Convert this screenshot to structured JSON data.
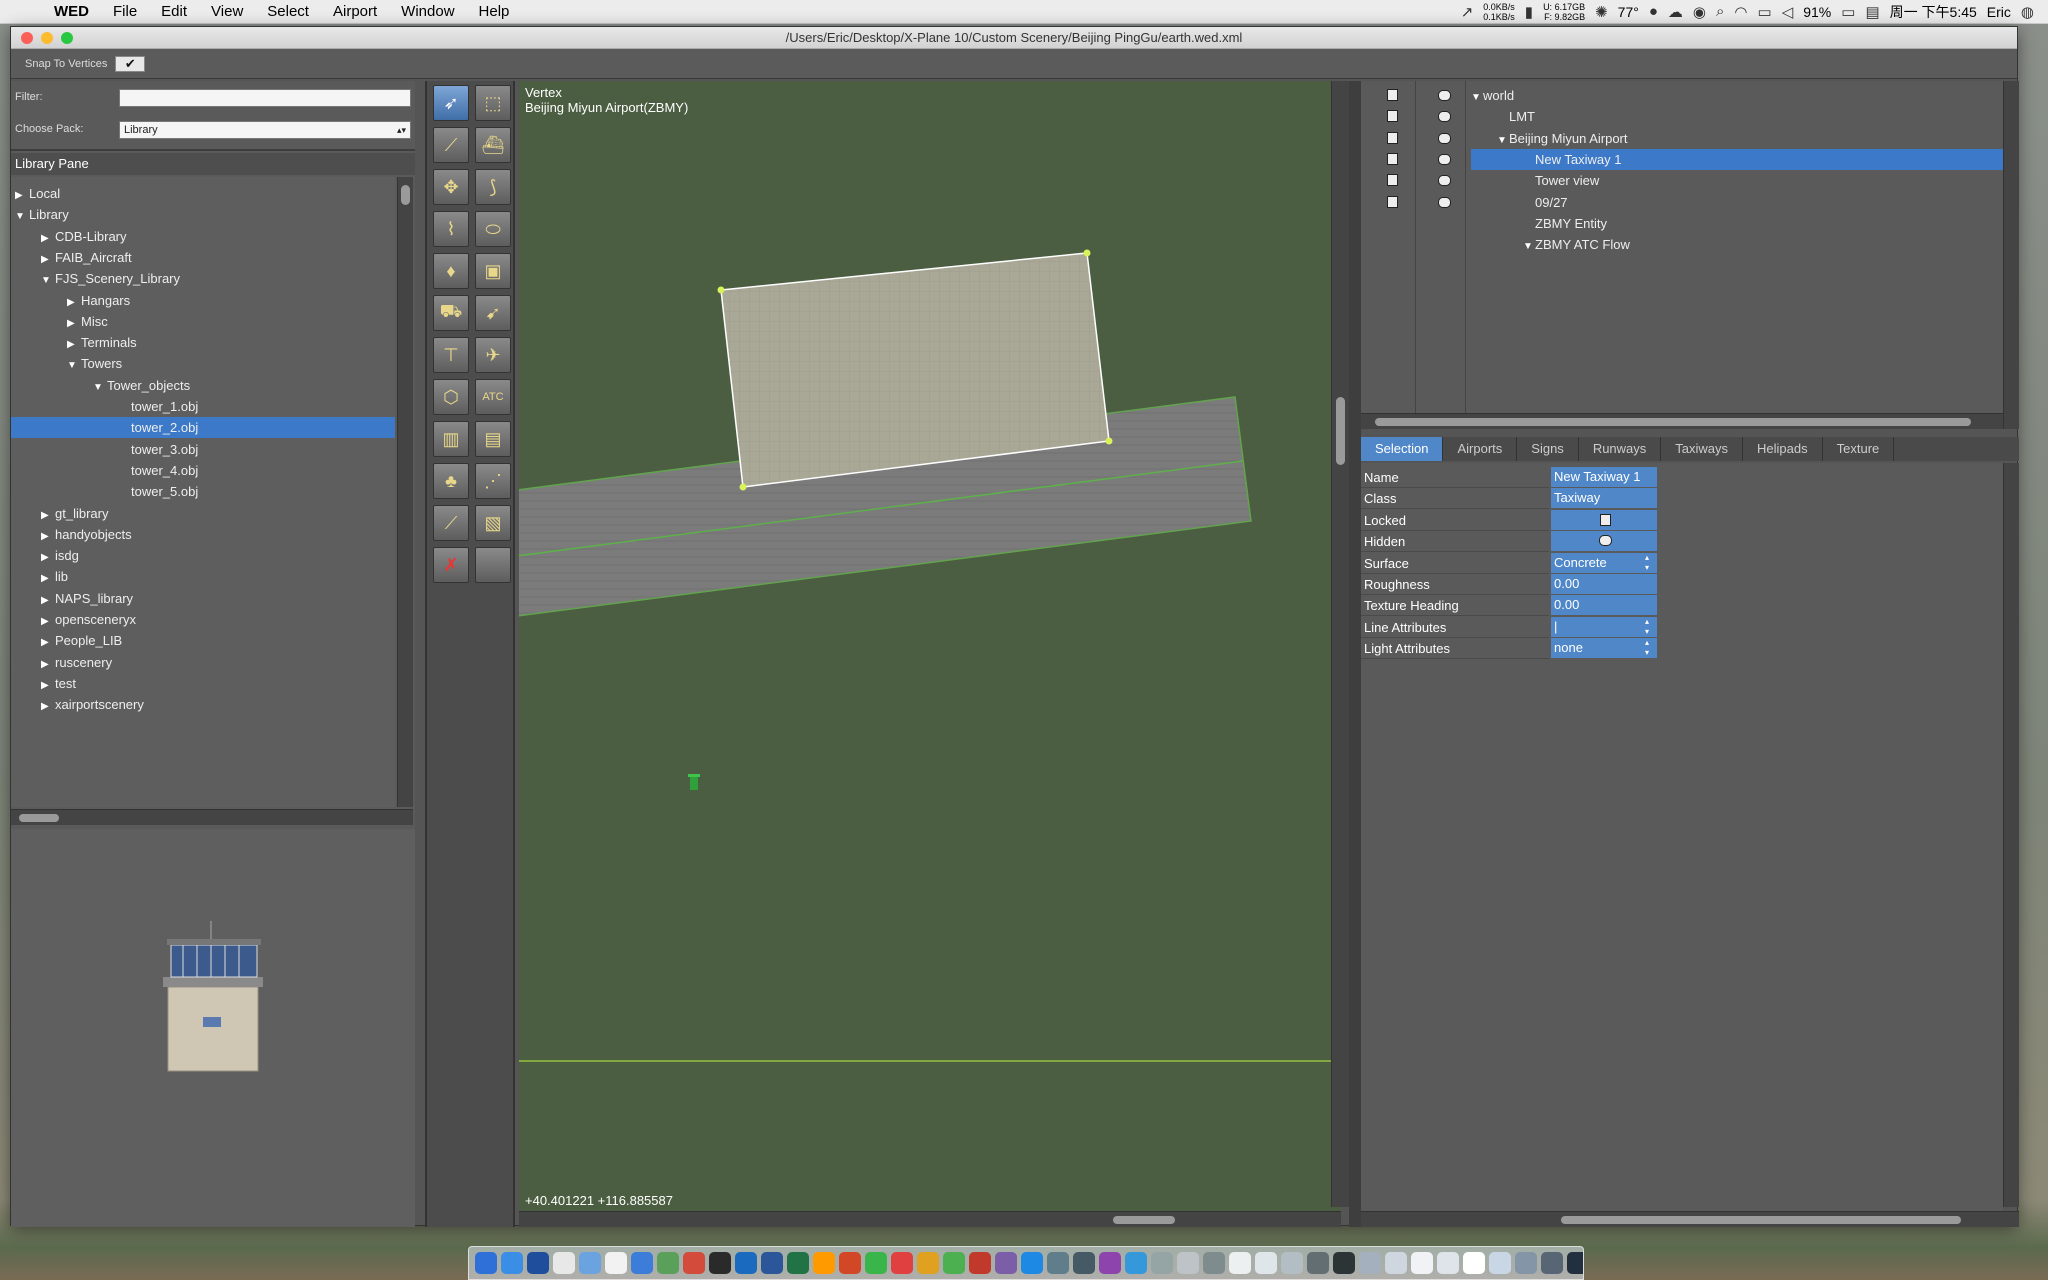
{
  "menubar": {
    "app": "WED",
    "items": [
      "File",
      "Edit",
      "View",
      "Select",
      "Airport",
      "Window",
      "Help"
    ],
    "net_up": "0.0KB/s",
    "net_down": "0.1KB/s",
    "mem_used": "U: 6.17GB",
    "mem_free": "F: 9.82GB",
    "temp": "77°",
    "battery": "91%",
    "clock": "周一 下午5:45",
    "user": "Eric"
  },
  "window": {
    "title": "/Users/Eric/Desktop/X-Plane 10/Custom Scenery/Beijing PingGu/earth.wed.xml",
    "snap_label": "Snap To Vertices",
    "snap_checked": "✔"
  },
  "library": {
    "filter_label": "Filter:",
    "filter_value": "",
    "pack_label": "Choose Pack:",
    "pack_value": "Library",
    "pane_title": "Library Pane",
    "items": [
      {
        "label": "Local",
        "depth": 0,
        "expanded": false,
        "selected": false
      },
      {
        "label": "Library",
        "depth": 0,
        "expanded": true,
        "selected": false
      },
      {
        "label": "CDB-Library",
        "depth": 1,
        "expanded": false,
        "selected": false
      },
      {
        "label": "FAIB_Aircraft",
        "depth": 1,
        "expanded": false,
        "selected": false
      },
      {
        "label": "FJS_Scenery_Library",
        "depth": 1,
        "expanded": true,
        "selected": false
      },
      {
        "label": "Hangars",
        "depth": 2,
        "expanded": false,
        "selected": false
      },
      {
        "label": "Misc",
        "depth": 2,
        "expanded": false,
        "selected": false
      },
      {
        "label": "Terminals",
        "depth": 2,
        "expanded": false,
        "selected": false
      },
      {
        "label": "Towers",
        "depth": 2,
        "expanded": true,
        "selected": false
      },
      {
        "label": "Tower_objects",
        "depth": 3,
        "expanded": true,
        "selected": false
      },
      {
        "label": "tower_1.obj",
        "depth": 4,
        "leaf": true,
        "selected": false
      },
      {
        "label": "tower_2.obj",
        "depth": 4,
        "leaf": true,
        "selected": true
      },
      {
        "label": "tower_3.obj",
        "depth": 4,
        "leaf": true,
        "selected": false
      },
      {
        "label": "tower_4.obj",
        "depth": 4,
        "leaf": true,
        "selected": false
      },
      {
        "label": "tower_5.obj",
        "depth": 4,
        "leaf": true,
        "selected": false
      },
      {
        "label": "gt_library",
        "depth": 1,
        "expanded": false,
        "selected": false
      },
      {
        "label": "handyobjects",
        "depth": 1,
        "expanded": false,
        "selected": false
      },
      {
        "label": "isdg",
        "depth": 1,
        "expanded": false,
        "selected": false
      },
      {
        "label": "lib",
        "depth": 1,
        "expanded": false,
        "selected": false
      },
      {
        "label": "NAPS_library",
        "depth": 1,
        "expanded": false,
        "selected": false
      },
      {
        "label": "opensceneryx",
        "depth": 1,
        "expanded": false,
        "selected": false
      },
      {
        "label": "People_LIB",
        "depth": 1,
        "expanded": false,
        "selected": false
      },
      {
        "label": "ruscenery",
        "depth": 1,
        "expanded": false,
        "selected": false
      },
      {
        "label": "test",
        "depth": 1,
        "expanded": false,
        "selected": false
      },
      {
        "label": "xairportscenery",
        "depth": 1,
        "expanded": false,
        "selected": false
      }
    ]
  },
  "tools": [
    "vertex-tool-icon",
    "marquee-tool-icon",
    "runway-tool-icon",
    "sealane-tool-icon",
    "helipad-tool-icon",
    "taxiway-tool-icon",
    "taxiline-tool-icon",
    "hole-tool-icon",
    "light-fixture-tool-icon",
    "sign-tool-icon",
    "ramp-start-tool-icon",
    "windsock-tool-icon",
    "tower-view-tool-icon",
    "airport-beacon-tool-icon",
    "boundary-tool-icon",
    "atc-route-tool-icon",
    "facade-tool-icon",
    "object-tool-icon",
    "forest-tool-icon",
    "string-tool-icon",
    "line-tool-icon",
    "polygon-tool-icon",
    "exclusion-tool-icon",
    "blank-tool-icon"
  ],
  "map": {
    "tool_name": "Vertex",
    "airport": "Beijing Miyun Airport(ZBMY)",
    "coords": "+40.401221 +116.885587"
  },
  "outline": {
    "items": [
      {
        "label": "world",
        "depth": 0,
        "expanded": true,
        "selected": false
      },
      {
        "label": "LMT",
        "depth": 1,
        "selected": false
      },
      {
        "label": "Beijing Miyun Airport",
        "depth": 1,
        "expanded": true,
        "selected": false
      },
      {
        "label": "New Taxiway 1",
        "depth": 2,
        "selected": true
      },
      {
        "label": "Tower view",
        "depth": 2,
        "selected": false
      },
      {
        "label": "09/27",
        "depth": 2,
        "selected": false
      },
      {
        "label": "ZBMY Entity",
        "depth": 2,
        "selected": false
      },
      {
        "label": "ZBMY ATC Flow",
        "depth": 2,
        "expanded": true,
        "selected": false
      }
    ]
  },
  "tabs": [
    "Selection",
    "Airports",
    "Signs",
    "Runways",
    "Taxiways",
    "Helipads",
    "Texture"
  ],
  "properties": [
    {
      "name": "Name",
      "value": "New Taxiway 1",
      "kind": "text"
    },
    {
      "name": "Class",
      "value": "Taxiway",
      "kind": "text"
    },
    {
      "name": "Locked",
      "value": "",
      "kind": "lock"
    },
    {
      "name": "Hidden",
      "value": "",
      "kind": "eye"
    },
    {
      "name": "Surface",
      "value": "Concrete",
      "kind": "select"
    },
    {
      "name": "Roughness",
      "value": "0.00",
      "kind": "text"
    },
    {
      "name": "Texture Heading",
      "value": " 0.00",
      "kind": "text"
    },
    {
      "name": "Line Attributes",
      "value": "|",
      "kind": "select"
    },
    {
      "name": "Light Attributes",
      "value": "none",
      "kind": "select"
    }
  ],
  "colors": {
    "selection": "#3c79c9",
    "map_ground": "#4b5e41",
    "panel": "#5e5e5e"
  }
}
